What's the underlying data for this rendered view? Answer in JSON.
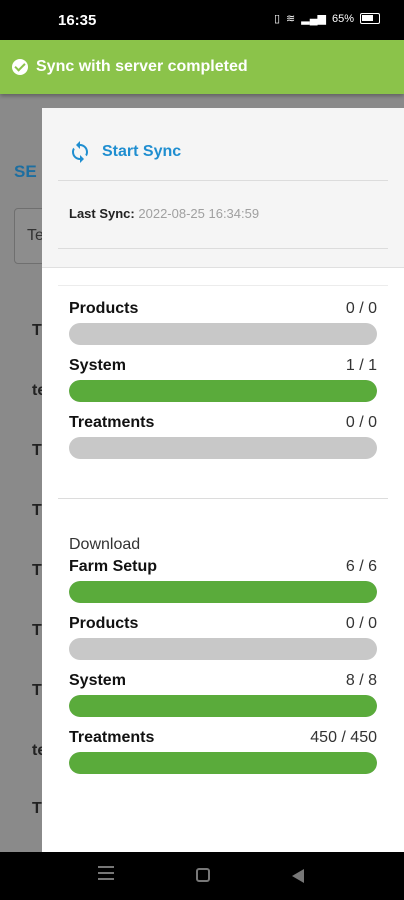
{
  "status_bar": {
    "time": "16:35",
    "battery": "65%"
  },
  "toast": {
    "message": "Sync with server completed",
    "color": "#8bc34a"
  },
  "background": {
    "section_label": "SE",
    "field_text": "Te",
    "rows": [
      "T",
      "te",
      "T",
      "T",
      "T",
      "T",
      "T",
      "te",
      "T"
    ]
  },
  "drawer": {
    "start_sync_label": "Start Sync",
    "last_sync_label": "Last Sync:",
    "last_sync_value": "2022-08-25 16:34:59",
    "upload_items": [
      {
        "name": "Products",
        "count": "0 / 0",
        "progress": 0
      },
      {
        "name": "System",
        "count": "1 / 1",
        "progress": 1
      },
      {
        "name": "Treatments",
        "count": "0 / 0",
        "progress": 0
      }
    ],
    "download_title": "Download",
    "download_items": [
      {
        "name": "Farm Setup",
        "count": "6 / 6",
        "progress": 1
      },
      {
        "name": "Products",
        "count": "0 / 0",
        "progress": 0
      },
      {
        "name": "System",
        "count": "8 / 8",
        "progress": 1
      },
      {
        "name": "Treatments",
        "count": "450 / 450",
        "progress": 1
      }
    ]
  },
  "colors": {
    "accent": "#1f8ed0",
    "progress_fill": "#5aab3b",
    "progress_track": "#c8c8c8"
  }
}
